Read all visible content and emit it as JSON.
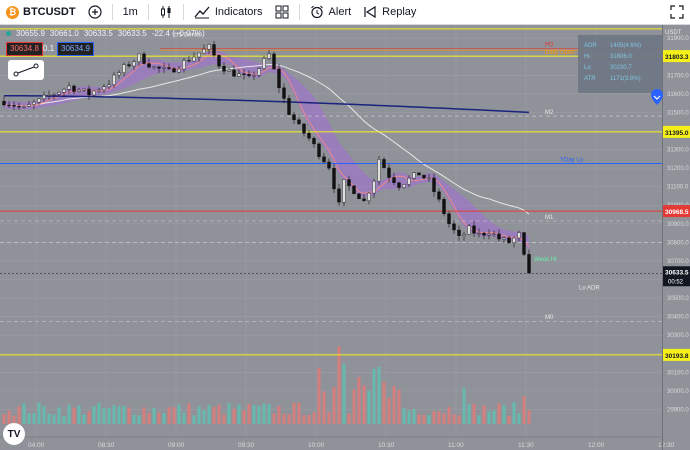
{
  "toolbar": {
    "symbol": "BTCUSDT",
    "interval": "1m",
    "indicators_label": "Indicators",
    "alert_label": "Alert",
    "replay_label": "Replay"
  },
  "legend": {
    "open": "30655.9",
    "high": "30661.0",
    "low": "30633.5",
    "close": "30633.5",
    "change": "-22.4 (−0.07%)",
    "bid": "30634.8",
    "spread": "0.1",
    "ask": "30634.9"
  },
  "currency": "USDT",
  "colors": {
    "background": "#8f9298",
    "up_candle": "#26a69a",
    "down_candle": "#ef5350",
    "yellow_line": "#f5f01a",
    "red_line": "#e53935",
    "blue_line": "#2962ff",
    "navy_ma": "#1a237e",
    "ribbon": "#a46bd8"
  },
  "chart_data": {
    "type": "candlestick",
    "x_tick_labels": [
      "04:00",
      "08:30",
      "09:00",
      "09:30",
      "10:00",
      "10:30",
      "11:00",
      "11:30",
      "12:00",
      "12:30"
    ],
    "y_tick_labels": [
      31900,
      31800,
      31700,
      31600,
      31500,
      31400,
      31300,
      31200,
      31100,
      31000,
      30900,
      30800,
      30700,
      30600,
      30500,
      30400,
      30300,
      30200,
      30100,
      30000,
      29900
    ],
    "ylim": [
      29870,
      31960
    ],
    "price_path": [
      [
        0,
        31560
      ],
      [
        4,
        31520
      ],
      [
        9,
        31590
      ],
      [
        13,
        31640
      ],
      [
        17,
        31600
      ],
      [
        21,
        31660
      ],
      [
        24,
        31740
      ],
      [
        27,
        31800
      ],
      [
        30,
        31740
      ],
      [
        33,
        31720
      ],
      [
        36,
        31770
      ],
      [
        39,
        31820
      ],
      [
        41,
        31850
      ],
      [
        43,
        31760
      ],
      [
        45,
        31720
      ],
      [
        47,
        31700
      ],
      [
        49,
        31680
      ],
      [
        51,
        31740
      ],
      [
        53,
        31810
      ],
      [
        55,
        31640
      ],
      [
        57,
        31500
      ],
      [
        59,
        31420
      ],
      [
        61,
        31360
      ],
      [
        63,
        31280
      ],
      [
        65,
        31210
      ],
      [
        67,
        31000
      ],
      [
        68,
        31120
      ],
      [
        70,
        31080
      ],
      [
        72,
        31020
      ],
      [
        74,
        31140
      ],
      [
        75,
        31250
      ],
      [
        77,
        31160
      ],
      [
        79,
        31110
      ],
      [
        81,
        31140
      ],
      [
        83,
        31170
      ],
      [
        85,
        31130
      ],
      [
        87,
        31020
      ],
      [
        89,
        30900
      ],
      [
        91,
        30820
      ],
      [
        93,
        30870
      ],
      [
        95,
        30840
      ],
      [
        97,
        30860
      ],
      [
        99,
        30820
      ],
      [
        101,
        30800
      ],
      [
        103,
        30840
      ],
      [
        104,
        30720
      ],
      [
        105,
        30634
      ]
    ],
    "horizontal_lines": [
      {
        "price": 31950,
        "color": "yellow",
        "label": ""
      },
      {
        "price": 31845,
        "color": "red",
        "label": "PD"
      },
      {
        "price": 31835,
        "color": "orange",
        "label": "Daily Open"
      },
      {
        "price": 31803.3,
        "color": "yellow",
        "label": "31803.3"
      },
      {
        "price": 31395.0,
        "color": "yellow",
        "label": "31395.0"
      },
      {
        "price": 31225,
        "color": "blue",
        "label": "YDay Lo"
      },
      {
        "price": 30968.5,
        "color": "red",
        "label": "30968.5"
      },
      {
        "price": 30193.8,
        "color": "yellow",
        "label": "30193.8"
      }
    ],
    "dashed_levels": [
      {
        "price": 31990,
        "label": ""
      },
      {
        "price": 31480,
        "label": "M2"
      },
      {
        "price": 30915,
        "label": "M1"
      },
      {
        "price": 30800,
        "label": ""
      },
      {
        "price": 30375,
        "label": "M0"
      }
    ],
    "annotations": [
      {
        "text": "US Brinks",
        "x": 34,
        "price": 31910
      },
      {
        "text": "Week Hi",
        "x": 106,
        "price": 30700
      },
      {
        "text": "Lo ADR",
        "x": 115,
        "price": 30545
      }
    ],
    "last_price": "30633.5",
    "countdown": "00:52",
    "info_rows": [
      [
        "ADR",
        "1405(4.6%)"
      ],
      [
        "Hi",
        "31806.0"
      ],
      [
        "Lo",
        "30230.7"
      ],
      [
        "ATR",
        "1171(3.8%)"
      ]
    ]
  }
}
